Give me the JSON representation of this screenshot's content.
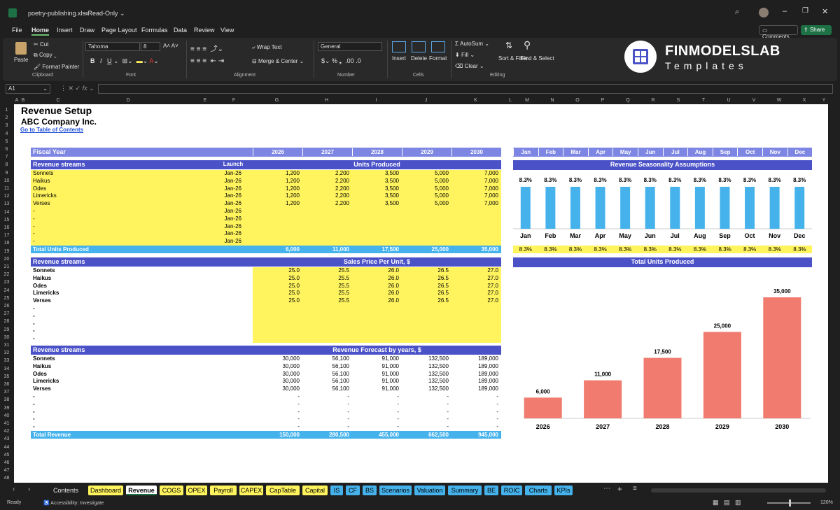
{
  "window": {
    "title": "poetry-publishing.xlsx",
    "mode": "Read-Only"
  },
  "menu": [
    "File",
    "Home",
    "Insert",
    "Draw",
    "Page Layout",
    "Formulas",
    "Data",
    "Review",
    "View"
  ],
  "header_buttons": {
    "comments": "Comments",
    "share": "Share"
  },
  "ribbon": {
    "paste": "Paste",
    "cut": "Cut",
    "copy": "Copy",
    "format_painter": "Format Painter",
    "clipboard": "Clipboard",
    "font_name": "Tahoma",
    "font_size": "8",
    "font_group": "Font",
    "wrap_text": "Wrap Text",
    "merge_center": "Merge & Center",
    "alignment": "Alignment",
    "number_format": "General",
    "number": "Number",
    "insert": "Insert",
    "delete": "Delete",
    "format": "Format",
    "cells": "Cells",
    "autosum": "AutoSum",
    "fill": "Fill",
    "clear": "Clear",
    "sort_filter": "Sort & Filter",
    "find_select": "Find & Select",
    "editing": "Editing"
  },
  "brand": {
    "name": "FINMODELSLAB",
    "tagline": "Templates"
  },
  "formula_bar": {
    "name_box": "A1",
    "formula": ""
  },
  "columns": [
    "A",
    "B",
    "C",
    "D",
    "E",
    "F",
    "G",
    "H",
    "I",
    "J",
    "K",
    "L",
    "M",
    "N",
    "O",
    "P",
    "Q",
    "R",
    "S",
    "T",
    "U",
    "V",
    "W",
    "X",
    "Y"
  ],
  "rows": [
    "1",
    "2",
    "3",
    "4",
    "5",
    "6",
    "7",
    "8",
    "9",
    "10",
    "11",
    "12",
    "13",
    "14",
    "15",
    "16",
    "17",
    "18",
    "19",
    "20",
    "21",
    "22",
    "23",
    "24",
    "25",
    "26",
    "27",
    "28",
    "29",
    "30",
    "31",
    "32",
    "33",
    "34",
    "35",
    "36",
    "37",
    "38",
    "39",
    "40",
    "41",
    "42",
    "43",
    "44",
    "45",
    "46",
    "47",
    "48"
  ],
  "sheet": {
    "title": "Revenue Setup",
    "company": "ABC Company Inc.",
    "toc_link": "Go to Table of Contents",
    "fiscal_year_label": "Fiscal Year",
    "years": [
      "2026",
      "2027",
      "2028",
      "2029",
      "2030"
    ],
    "months": [
      "Jan",
      "Feb",
      "Mar",
      "Apr",
      "May",
      "Jun",
      "Jul",
      "Aug",
      "Sep",
      "Oct",
      "Nov",
      "Dec"
    ],
    "units_section": {
      "label": "Revenue streams",
      "launch_label": "Launch",
      "header": "Units Produced",
      "rows": [
        {
          "name": "Sonnets",
          "launch": "Jan-26",
          "values": [
            "1,200",
            "2,200",
            "3,500",
            "5,000",
            "7,000"
          ]
        },
        {
          "name": "Haikus",
          "launch": "Jan-26",
          "values": [
            "1,200",
            "2,200",
            "3,500",
            "5,000",
            "7,000"
          ]
        },
        {
          "name": "Odes",
          "launch": "Jan-26",
          "values": [
            "1,200",
            "2,200",
            "3,500",
            "5,000",
            "7,000"
          ]
        },
        {
          "name": "Limericks",
          "launch": "Jan-26",
          "values": [
            "1,200",
            "2,200",
            "3,500",
            "5,000",
            "7,000"
          ]
        },
        {
          "name": "Verses",
          "launch": "Jan-26",
          "values": [
            "1,200",
            "2,200",
            "3,500",
            "5,000",
            "7,000"
          ]
        },
        {
          "name": "-",
          "launch": "Jan-26",
          "values": [
            "",
            "",
            "",
            "",
            ""
          ]
        },
        {
          "name": "-",
          "launch": "Jan-26",
          "values": [
            "",
            "",
            "",
            "",
            ""
          ]
        },
        {
          "name": "-",
          "launch": "Jan-26",
          "values": [
            "",
            "",
            "",
            "",
            ""
          ]
        },
        {
          "name": "-",
          "launch": "Jan-26",
          "values": [
            "",
            "",
            "",
            "",
            ""
          ]
        },
        {
          "name": "-",
          "launch": "Jan-26",
          "values": [
            "",
            "",
            "",
            "",
            ""
          ]
        }
      ],
      "total_label": "Total Units Produced",
      "totals": [
        "6,000",
        "11,000",
        "17,500",
        "25,000",
        "35,000"
      ]
    },
    "price_section": {
      "label": "Revenue streams",
      "header": "Sales Price Per Unit, $",
      "rows": [
        {
          "name": "Sonnets",
          "values": [
            "25.0",
            "25.5",
            "26.0",
            "26.5",
            "27.0"
          ]
        },
        {
          "name": "Haikus",
          "values": [
            "25.0",
            "25.5",
            "26.0",
            "26.5",
            "27.0"
          ]
        },
        {
          "name": "Odes",
          "values": [
            "25.0",
            "25.5",
            "26.0",
            "26.5",
            "27.0"
          ]
        },
        {
          "name": "Limericks",
          "values": [
            "25.0",
            "25.5",
            "26.0",
            "26.5",
            "27.0"
          ]
        },
        {
          "name": "Verses",
          "values": [
            "25.0",
            "25.5",
            "26.0",
            "26.5",
            "27.0"
          ]
        },
        {
          "name": "-",
          "values": [
            "",
            "",
            "",
            "",
            ""
          ]
        },
        {
          "name": "-",
          "values": [
            "",
            "",
            "",
            "",
            ""
          ]
        },
        {
          "name": "-",
          "values": [
            "",
            "",
            "",
            "",
            ""
          ]
        },
        {
          "name": "-",
          "values": [
            "",
            "",
            "",
            "",
            ""
          ]
        },
        {
          "name": "-",
          "values": [
            "",
            "",
            "",
            "",
            ""
          ]
        }
      ]
    },
    "revenue_section": {
      "label": "Revenue streams",
      "header": "Revenue Forecast by years, $",
      "rows": [
        {
          "name": "Sonnets",
          "values": [
            "30,000",
            "56,100",
            "91,000",
            "132,500",
            "189,000"
          ]
        },
        {
          "name": "Haikus",
          "values": [
            "30,000",
            "56,100",
            "91,000",
            "132,500",
            "189,000"
          ]
        },
        {
          "name": "Odes",
          "values": [
            "30,000",
            "56,100",
            "91,000",
            "132,500",
            "189,000"
          ]
        },
        {
          "name": "Limericks",
          "values": [
            "30,000",
            "56,100",
            "91,000",
            "132,500",
            "189,000"
          ]
        },
        {
          "name": "Verses",
          "values": [
            "30,000",
            "56,100",
            "91,000",
            "132,500",
            "189,000"
          ]
        },
        {
          "name": "-",
          "values": [
            "-",
            "-",
            "-",
            "-",
            "-"
          ]
        },
        {
          "name": "-",
          "values": [
            "-",
            "-",
            "-",
            "-",
            "-"
          ]
        },
        {
          "name": "-",
          "values": [
            "-",
            "-",
            "-",
            "-",
            "-"
          ]
        },
        {
          "name": "-",
          "values": [
            "-",
            "-",
            "-",
            "-",
            "-"
          ]
        },
        {
          "name": "-",
          "values": [
            "-",
            "-",
            "-",
            "-",
            "-"
          ]
        }
      ],
      "total_label": "Total Revenue",
      "totals": [
        "150,000",
        "280,500",
        "455,000",
        "662,500",
        "945,000"
      ]
    },
    "seasonality": {
      "header": "Revenue Seasonality Assumptions",
      "values": [
        "8.3%",
        "8.3%",
        "8.3%",
        "8.3%",
        "8.3%",
        "8.3%",
        "8.3%",
        "8.3%",
        "8.3%",
        "8.3%",
        "8.3%",
        "8.3%"
      ]
    },
    "units_chart_header": "Total Units Produced"
  },
  "chart_data": [
    {
      "type": "bar",
      "title": "Revenue Seasonality Assumptions",
      "categories": [
        "Jan",
        "Feb",
        "Mar",
        "Apr",
        "May",
        "Jun",
        "Jul",
        "Aug",
        "Sep",
        "Oct",
        "Nov",
        "Dec"
      ],
      "values": [
        8.3,
        8.3,
        8.3,
        8.3,
        8.3,
        8.3,
        8.3,
        8.3,
        8.3,
        8.3,
        8.3,
        8.3
      ],
      "data_labels": [
        "8.3%",
        "8.3%",
        "8.3%",
        "8.3%",
        "8.3%",
        "8.3%",
        "8.3%",
        "8.3%",
        "8.3%",
        "8.3%",
        "8.3%",
        "8.3%"
      ],
      "color": "#45b2ec"
    },
    {
      "type": "bar",
      "title": "Total Units Produced",
      "categories": [
        "2026",
        "2027",
        "2028",
        "2029",
        "2030"
      ],
      "values": [
        6000,
        11000,
        17500,
        25000,
        35000
      ],
      "data_labels": [
        "6,000",
        "11,000",
        "17,500",
        "25,000",
        "35,000"
      ],
      "color": "#f07b6e"
    }
  ],
  "tabs": [
    {
      "label": "Contents",
      "color": "#1f1f1f",
      "fg": "#e8e8e8"
    },
    {
      "label": "Dashboard",
      "color": "#fff45e"
    },
    {
      "label": "Revenue",
      "color": "#ffffff",
      "active": true
    },
    {
      "label": "COGS",
      "color": "#fff45e"
    },
    {
      "label": "OPEX",
      "color": "#fff45e"
    },
    {
      "label": "Payroll",
      "color": "#fff45e"
    },
    {
      "label": "CAPEX",
      "color": "#fff45e"
    },
    {
      "label": "CapTable",
      "color": "#fff45e"
    },
    {
      "label": "Capital",
      "color": "#fff45e"
    },
    {
      "label": "IS",
      "color": "#45b2ec"
    },
    {
      "label": "CF",
      "color": "#45b2ec"
    },
    {
      "label": "BS",
      "color": "#45b2ec"
    },
    {
      "label": "Scenarios",
      "color": "#45b2ec"
    },
    {
      "label": "Valuation",
      "color": "#45b2ec"
    },
    {
      "label": "Summary",
      "color": "#45b2ec"
    },
    {
      "label": "BE",
      "color": "#45b2ec"
    },
    {
      "label": "ROIC",
      "color": "#45b2ec"
    },
    {
      "label": "Charts",
      "color": "#45b2ec"
    },
    {
      "label": "KPIs",
      "color": "#45b2ec"
    }
  ],
  "status": {
    "ready": "Ready",
    "accessibility": "Accessibility: Investigate",
    "zoom": "120%"
  }
}
